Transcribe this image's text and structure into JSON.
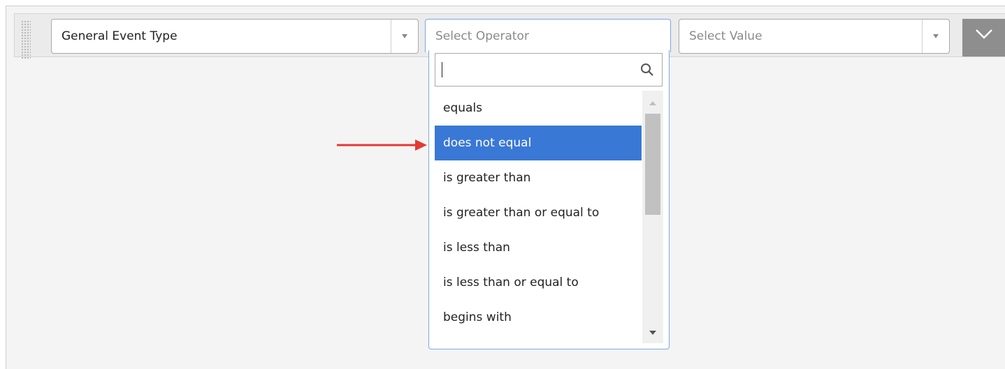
{
  "filter_row": {
    "field": {
      "value": "General Event Type",
      "icon": "triangle-down-icon"
    },
    "operator": {
      "placeholder": "Select Operator",
      "search": {
        "value": "",
        "icon": "search-icon"
      },
      "options": [
        "equals",
        "does not equal",
        "is greater than",
        "is greater than or equal to",
        "is less than",
        "is less than or equal to",
        "begins with"
      ],
      "highlighted": "does not equal"
    },
    "value": {
      "placeholder": "Select Value",
      "icon": "triangle-down-icon"
    },
    "collapse_icon": "chevron-down-icon"
  },
  "colors": {
    "highlight": "#3a78d6",
    "annotation_arrow": "#e53935",
    "focus_border": "#7aa7e6"
  }
}
